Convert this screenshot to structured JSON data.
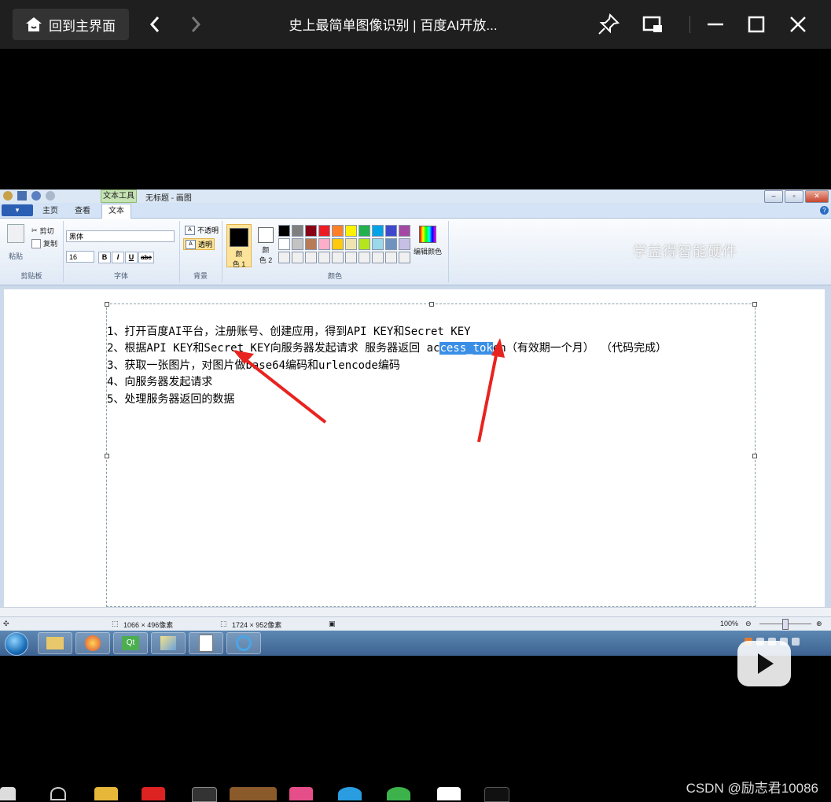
{
  "player": {
    "home_label": "回到主界面",
    "title": "史上最简单图像识别 | 百度AI开放..."
  },
  "paint": {
    "title_tab": "文本工具",
    "doc_title": "无标题 - 画图",
    "file_button": "▾",
    "tabs": [
      "主页",
      "查看",
      "文本"
    ],
    "active_tab": "文本",
    "clipboard": {
      "paste": "粘贴",
      "cut": "剪切",
      "copy": "复制",
      "label": "剪贴板"
    },
    "font": {
      "family": "黑体",
      "size": "16",
      "bold": "B",
      "italic": "I",
      "underline": "U",
      "strike": "abc",
      "label": "字体"
    },
    "background": {
      "opaque": "不透明",
      "transparent": "透明",
      "label": "背景"
    },
    "colors": {
      "color1_label_a": "颜",
      "color1_label_b": "色 1",
      "color2_label_a": "颜",
      "color2_label_b": "色 2",
      "edit_colors": "编辑颜色",
      "label": "颜色",
      "color1": "#000000",
      "color2": "#ffffff",
      "palette": [
        "#000000",
        "#7f7f7f",
        "#880015",
        "#ed1c24",
        "#ff7f27",
        "#fff200",
        "#22b14c",
        "#00a2e8",
        "#3f48cc",
        "#a349a4",
        "#ffffff",
        "#c3c3c3",
        "#b97a57",
        "#ffaec9",
        "#ffc90e",
        "#efe4b0",
        "#b5e61d",
        "#99d9ea",
        "#7092be",
        "#c8bfe7",
        "#f0f0f0",
        "#f0f0f0",
        "#f0f0f0",
        "#f0f0f0",
        "#f0f0f0",
        "#f0f0f0",
        "#f0f0f0",
        "#f0f0f0",
        "#f0f0f0",
        "#f0f0f0"
      ]
    },
    "watermark": "学益得智能硬件",
    "lines": {
      "l1": "1、打开百度AI平台，注册账号、创建应用，得到API KEY和Secret KEY",
      "l2_pre": "2、根据API KEY和Secret KEY向服务器发起请求 服务器返回 ac",
      "l2_hl": "cess_tok",
      "l2_post": "en（有效期一个月） （代码完成）",
      "l3": "3、获取一张图片，对图片做base64编码和urlencode编码",
      "l4": "4、向服务器发起请求",
      "l5": "5、处理服务器返回的数据"
    },
    "status": {
      "selection": "1066 × 496像素",
      "canvas": "1724 × 952像素",
      "zoom": "100%"
    }
  },
  "csdn_mark": "CSDN @励志君10086",
  "accent": "#3a8ee6"
}
